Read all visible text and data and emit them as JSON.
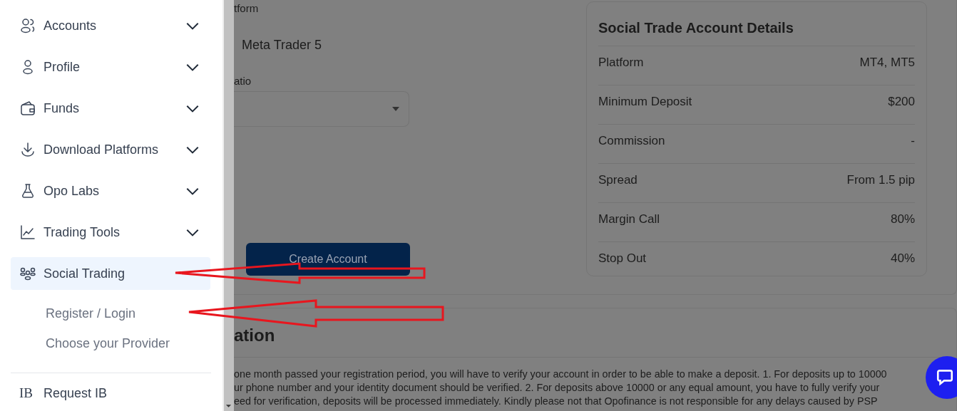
{
  "sidebar": {
    "items": [
      {
        "label": "Accounts",
        "kind": "users",
        "expanded": false,
        "selected": false
      },
      {
        "label": "Profile",
        "kind": "user",
        "expanded": false,
        "selected": false
      },
      {
        "label": "Funds",
        "kind": "wallet",
        "expanded": false,
        "selected": false
      },
      {
        "label": "Download Platforms",
        "kind": "download",
        "expanded": false,
        "selected": false
      },
      {
        "label": "Opo Labs",
        "kind": "flask",
        "expanded": false,
        "selected": false
      },
      {
        "label": "Trading Tools",
        "kind": "chart",
        "expanded": false,
        "selected": false
      },
      {
        "label": "Social Trading",
        "kind": "group",
        "expanded": true,
        "selected": true,
        "children": [
          {
            "label": "Register / Login"
          },
          {
            "label": "Choose your Provider"
          }
        ]
      }
    ],
    "bottom_item": {
      "badge": "IB",
      "label": "Request IB"
    }
  },
  "form": {
    "platform_label": "tform",
    "platform_value": "Meta Trader 5",
    "ratio_label": "atio",
    "button": "Create Account"
  },
  "details": {
    "title": "Social Trade Account Details",
    "rows": [
      {
        "label": "Platform",
        "value": "MT4, MT5"
      },
      {
        "label": "Minimum Deposit",
        "value": "$200"
      },
      {
        "label": "Commission",
        "value": "-"
      },
      {
        "label": "Spread",
        "value": "From 1.5 pip"
      },
      {
        "label": "Margin Call",
        "value": "80%"
      },
      {
        "label": "Stop Out",
        "value": "40%"
      }
    ]
  },
  "verification": {
    "heading": "ation",
    "lines": [
      "one month passed your registration period, you will have to verify your account in order to be able to make a deposit. 1. For deposits up to 10000",
      "ur phone number and your identity document should be verified. 2. For deposits above 10000 or any equal amount, you have to fully verify your",
      "eed for verification, deposits will be processed immediately. Kindly please not that Opofinance is not responsible for any delays caused by PSP"
    ]
  }
}
